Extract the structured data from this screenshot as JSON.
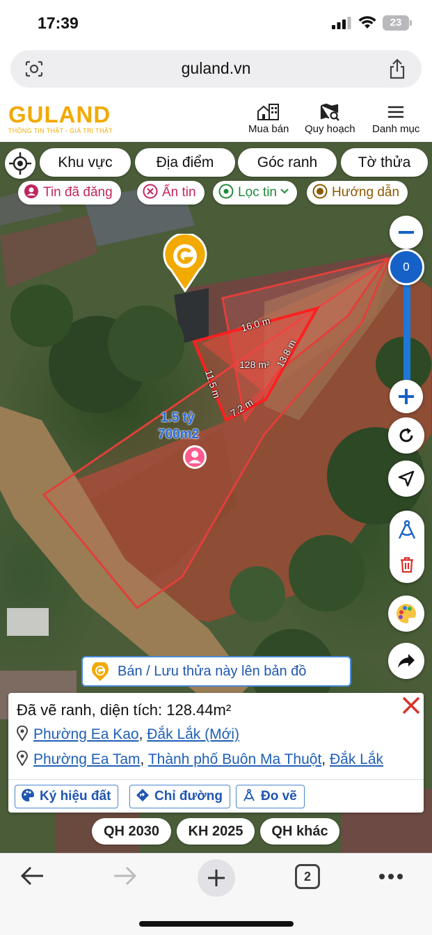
{
  "status": {
    "time": "17:39",
    "battery": "23"
  },
  "browser": {
    "url": "guland.vn",
    "tab_count": "2"
  },
  "app": {
    "logo": "GULAND",
    "tagline": "THÔNG TIN THẬT - GIÁ TRỊ THẬT",
    "nav": [
      {
        "label": "Mua bán",
        "icon": "building-icon"
      },
      {
        "label": "Quy hoạch",
        "icon": "map-search-icon"
      },
      {
        "label": "Danh mục",
        "icon": "menu-icon"
      }
    ]
  },
  "filters": {
    "row1": [
      "Khu vực",
      "Địa điểm",
      "Góc ranh",
      "Tờ thửa"
    ],
    "row2": [
      {
        "label": "Tin đã đăng",
        "icon": "user-circle-icon",
        "color": "#c0265e"
      },
      {
        "label": "Ẩn tin",
        "icon": "x-circle-icon",
        "color": "#c0265e"
      },
      {
        "label": "Lọc tin",
        "icon": "location-check-icon",
        "color": "#1f8a3a"
      },
      {
        "label": "Hướng dẫn",
        "icon": "play-circle-icon",
        "color": "#8a5a00"
      }
    ]
  },
  "map": {
    "zoom_value": "0",
    "listing_price": "1.5 tỷ",
    "listing_area": "700m2",
    "edge_labels": [
      "16.0 m",
      "13.8 m",
      "11.5 m",
      "7.2 m"
    ],
    "polygon_area_label": "128 m²"
  },
  "sell_banner": "Bán / Lưu thửa này lên bản đồ",
  "panel": {
    "title": "Đã vẽ ranh, diện tích: 128.44m²",
    "addr1": {
      "ward": "Phường Ea Kao",
      "province": "Đắk Lắk (Mới)"
    },
    "addr2": {
      "ward": "Phường Ea Tam",
      "city": "Thành phố Buôn Ma Thuột",
      "province": "Đắk Lắk"
    },
    "buttons": [
      "Ký hiệu đất",
      "Chỉ đường",
      "Đo vẽ"
    ]
  },
  "plans": [
    "QH 2030",
    "KH 2025",
    "QH khác"
  ],
  "colors": {
    "accent": "#f2a900",
    "link": "#1f5fb8",
    "polygon": "#ff2a2a",
    "zoom": "#1661c7"
  }
}
